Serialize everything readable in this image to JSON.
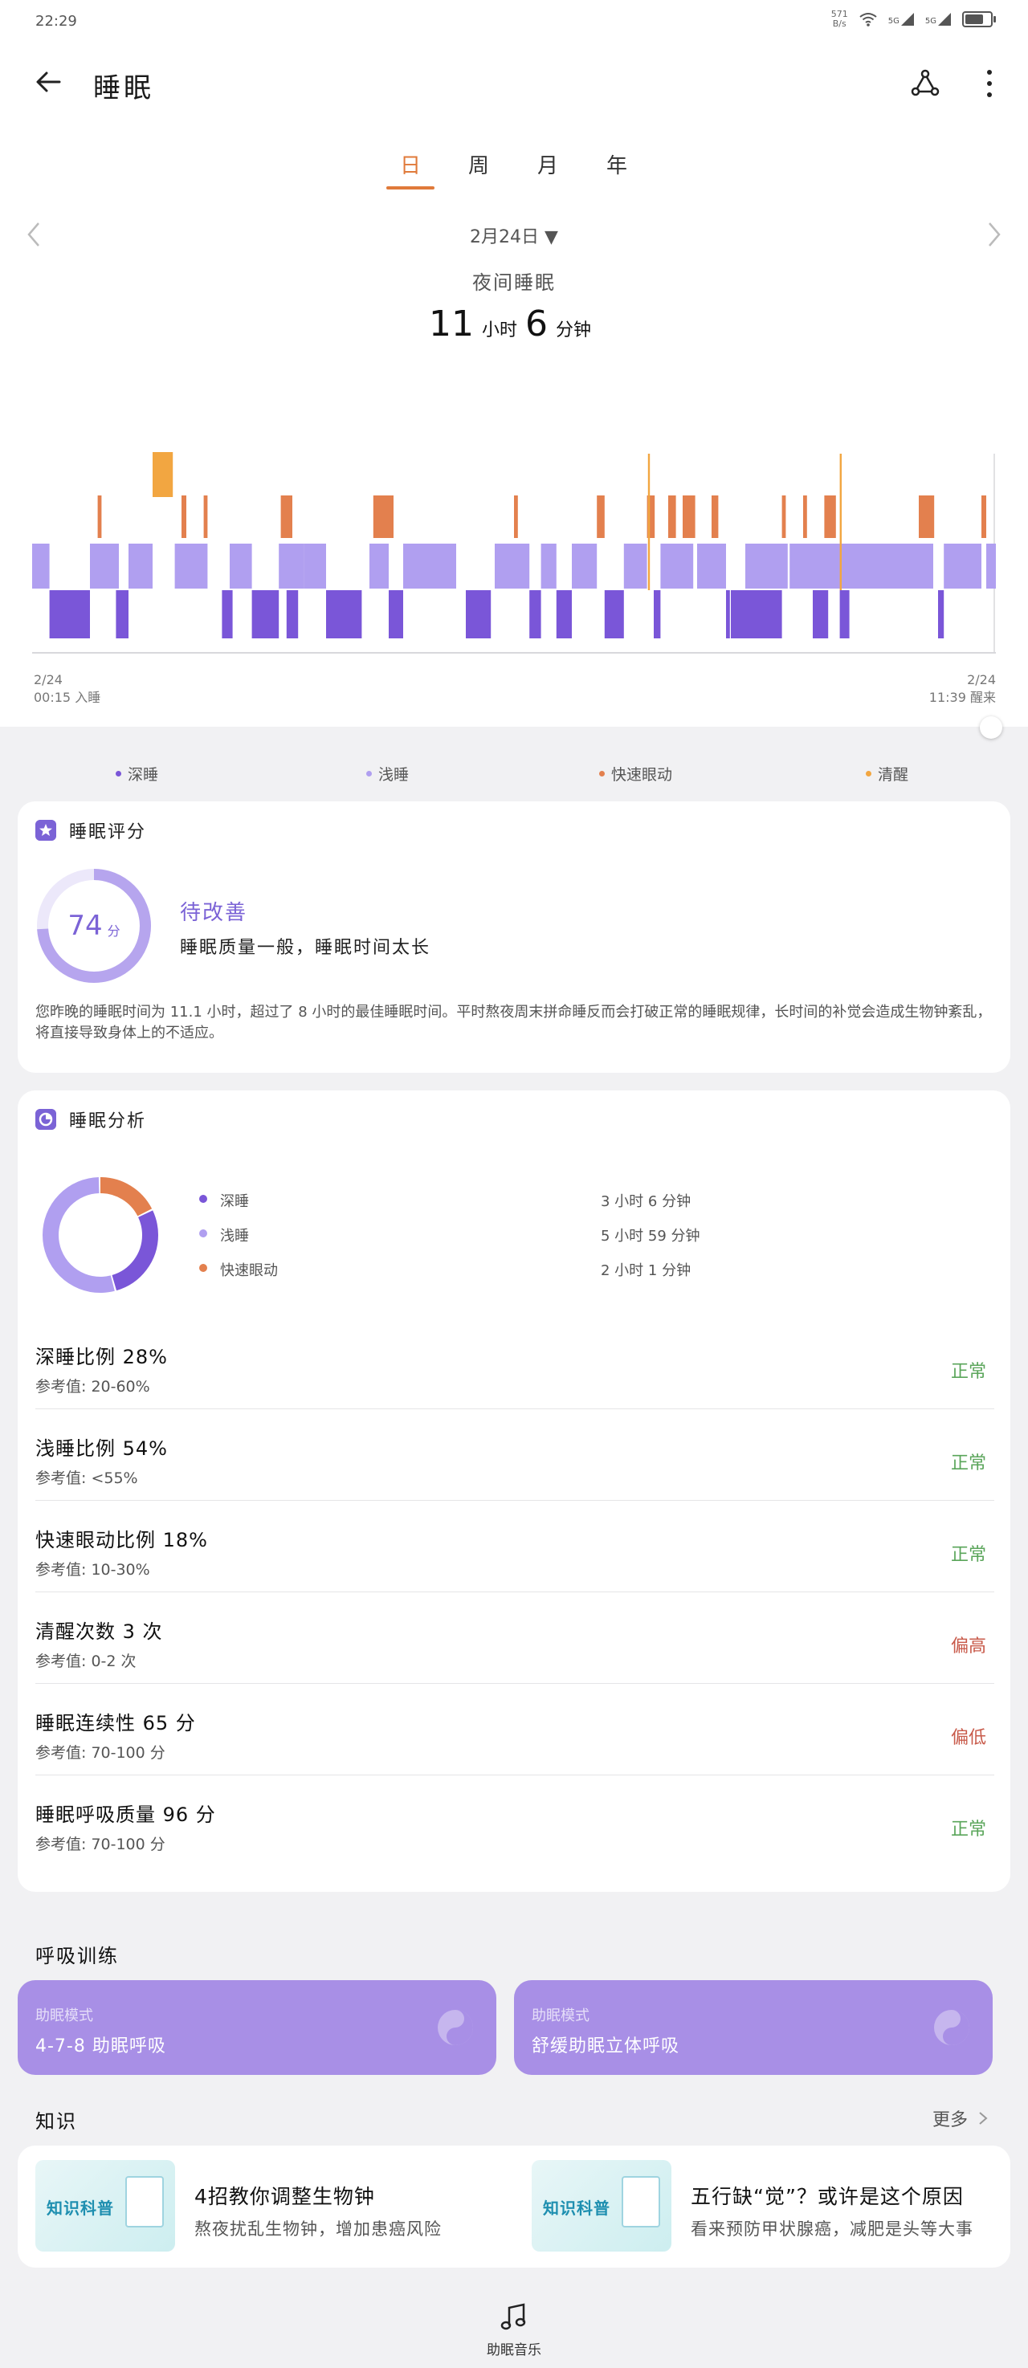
{
  "status_bar": {
    "time": "22:29",
    "net_speed": "571",
    "net_unit": "B/s",
    "signal1": "5G",
    "signal2": "5G"
  },
  "header": {
    "title": "睡眠"
  },
  "tabs": [
    {
      "label": "日",
      "active": true
    },
    {
      "label": "周",
      "active": false
    },
    {
      "label": "月",
      "active": false
    },
    {
      "label": "年",
      "active": false
    }
  ],
  "date_selector": {
    "date": "2月24日 ▼"
  },
  "summary": {
    "label": "夜间睡眠",
    "hours": "11",
    "hours_unit": "小时",
    "minutes": "6",
    "minutes_unit": "分钟"
  },
  "chart_labels": {
    "start_date": "2/24",
    "start_time": "00:15 入睡",
    "end_date": "2/24",
    "end_time": "11:39 醒来"
  },
  "chart_data": {
    "type": "timeline",
    "x_range": [
      "00:15",
      "11:39"
    ],
    "stages": [
      "清醒",
      "快速眼动",
      "浅睡",
      "深睡"
    ],
    "segments": [
      {
        "stage": "浅睡",
        "start": 0.0,
        "end": 0.018
      },
      {
        "stage": "深睡",
        "start": 0.018,
        "end": 0.06
      },
      {
        "stage": "浅睡",
        "start": 0.06,
        "end": 0.09
      },
      {
        "stage": "快速眼动",
        "start": 0.068,
        "end": 0.072
      },
      {
        "stage": "浅睡",
        "start": 0.062,
        "end": 0.078
      },
      {
        "stage": "深睡",
        "start": 0.087,
        "end": 0.1
      },
      {
        "stage": "浅睡",
        "start": 0.1,
        "end": 0.125
      },
      {
        "stage": "清醒",
        "start": 0.125,
        "end": 0.146
      },
      {
        "stage": "浅睡",
        "start": 0.148,
        "end": 0.182
      },
      {
        "stage": "快速眼动",
        "start": 0.155,
        "end": 0.16
      },
      {
        "stage": "快速眼动",
        "start": 0.178,
        "end": 0.182
      },
      {
        "stage": "深睡",
        "start": 0.197,
        "end": 0.208
      },
      {
        "stage": "浅睡",
        "start": 0.205,
        "end": 0.228
      },
      {
        "stage": "深睡",
        "start": 0.228,
        "end": 0.256
      },
      {
        "stage": "浅睡",
        "start": 0.256,
        "end": 0.282
      },
      {
        "stage": "深睡",
        "start": 0.264,
        "end": 0.276
      },
      {
        "stage": "快速眼动",
        "start": 0.258,
        "end": 0.27
      },
      {
        "stage": "浅睡",
        "start": 0.282,
        "end": 0.305
      },
      {
        "stage": "深睡",
        "start": 0.305,
        "end": 0.342
      },
      {
        "stage": "快速眼动",
        "start": 0.354,
        "end": 0.358
      },
      {
        "stage": "浅睡",
        "start": 0.35,
        "end": 0.37
      },
      {
        "stage": "深睡",
        "start": 0.37,
        "end": 0.385
      },
      {
        "stage": "快速眼动",
        "start": 0.357,
        "end": 0.375
      },
      {
        "stage": "浅睡",
        "start": 0.385,
        "end": 0.44
      },
      {
        "stage": "深睡",
        "start": 0.45,
        "end": 0.476
      },
      {
        "stage": "浅睡",
        "start": 0.48,
        "end": 0.516
      },
      {
        "stage": "快速眼动",
        "start": 0.5,
        "end": 0.504
      },
      {
        "stage": "深睡",
        "start": 0.516,
        "end": 0.528
      },
      {
        "stage": "浅睡",
        "start": 0.528,
        "end": 0.544
      },
      {
        "stage": "深睡",
        "start": 0.544,
        "end": 0.56
      },
      {
        "stage": "浅睡",
        "start": 0.56,
        "end": 0.586
      },
      {
        "stage": "快速眼动",
        "start": 0.586,
        "end": 0.594
      },
      {
        "stage": "深睡",
        "start": 0.594,
        "end": 0.614
      },
      {
        "stage": "浅睡",
        "start": 0.614,
        "end": 0.638
      },
      {
        "stage": "快速眼动",
        "start": 0.638,
        "end": 0.646
      },
      {
        "stage": "深睡",
        "start": 0.645,
        "end": 0.652
      },
      {
        "stage": "浅睡",
        "start": 0.652,
        "end": 0.686
      },
      {
        "stage": "快速眼动",
        "start": 0.66,
        "end": 0.668
      },
      {
        "stage": "快速眼动",
        "start": 0.675,
        "end": 0.688
      },
      {
        "stage": "浅睡",
        "start": 0.69,
        "end": 0.72
      },
      {
        "stage": "快速眼动",
        "start": 0.705,
        "end": 0.712
      },
      {
        "stage": "深睡",
        "start": 0.72,
        "end": 0.724
      },
      {
        "stage": "浅睡",
        "start": 0.74,
        "end": 0.784
      },
      {
        "stage": "深睡",
        "start": 0.725,
        "end": 0.778
      },
      {
        "stage": "快速眼动",
        "start": 0.778,
        "end": 0.782
      },
      {
        "stage": "快速眼动",
        "start": 0.8,
        "end": 0.804
      },
      {
        "stage": "快速眼动",
        "start": 0.822,
        "end": 0.834
      },
      {
        "stage": "浅睡",
        "start": 0.786,
        "end": 0.86
      },
      {
        "stage": "深睡",
        "start": 0.81,
        "end": 0.826
      },
      {
        "stage": "深睡",
        "start": 0.838,
        "end": 0.848
      },
      {
        "stage": "浅睡",
        "start": 0.86,
        "end": 0.9
      },
      {
        "stage": "快速眼动",
        "start": 0.92,
        "end": 0.936
      },
      {
        "stage": "浅睡",
        "start": 0.9,
        "end": 0.935
      },
      {
        "stage": "深睡",
        "start": 0.94,
        "end": 0.946
      },
      {
        "stage": "浅睡",
        "start": 0.946,
        "end": 0.985
      },
      {
        "stage": "快速眼动",
        "start": 0.985,
        "end": 0.99
      },
      {
        "stage": "浅睡",
        "start": 0.99,
        "end": 1.0
      },
      {
        "stage": "清醒",
        "start": 0.639,
        "end": 0.641
      },
      {
        "stage": "清醒",
        "start": 0.838,
        "end": 0.84
      }
    ],
    "grid": false
  },
  "legend": [
    {
      "label": "深睡",
      "color": "#7a56d8"
    },
    {
      "label": "浅睡",
      "color": "#b09ff0"
    },
    {
      "label": "快速眼动",
      "color": "#e3804e"
    },
    {
      "label": "清醒",
      "color": "#f2a641"
    }
  ],
  "score_card": {
    "title": "睡眠评分",
    "score": "74",
    "score_unit": "分",
    "score_fraction": 0.74,
    "status": "待改善",
    "description": "睡眠质量一般，睡眠时间太长",
    "paragraph": "您昨晚的睡眠时间为 11.1 小时，超过了 8 小时的最佳睡眠时间。平时熬夜周末拼命睡反而会打破正常的睡眠规律，长时间的补觉会造成生物钟紊乱，将直接导致身体上的不适应。"
  },
  "analysis_card": {
    "title": "睡眠分析",
    "breakdown": [
      {
        "label": "深睡",
        "value": "3 小时 6 分钟",
        "color": "#7a56d8",
        "percent": 28
      },
      {
        "label": "浅睡",
        "value": "5 小时 59 分钟",
        "color": "#b09ff0",
        "percent": 54
      },
      {
        "label": "快速眼动",
        "value": "2 小时 1 分钟",
        "color": "#e3804e",
        "percent": 18
      }
    ],
    "metrics": [
      {
        "name": "深睡比例  28%",
        "ref": "参考值:  20-60%",
        "status": "正常",
        "status_color": "#5aa55a"
      },
      {
        "name": "浅睡比例  54%",
        "ref": "参考值:  <55%",
        "status": "正常",
        "status_color": "#5aa55a"
      },
      {
        "name": "快速眼动比例  18%",
        "ref": "参考值:  10-30%",
        "status": "正常",
        "status_color": "#5aa55a"
      },
      {
        "name": "清醒次数  3  次",
        "ref": "参考值:  0-2  次",
        "status": "偏高",
        "status_color": "#c85a4a"
      },
      {
        "name": "睡眠连续性  65  分",
        "ref": "参考值:  70-100  分",
        "status": "偏低",
        "status_color": "#c85a4a"
      },
      {
        "name": "睡眠呼吸质量  96  分",
        "ref": "参考值:  70-100  分",
        "status": "正常",
        "status_color": "#5aa55a"
      }
    ]
  },
  "breathing": {
    "title": "呼吸训练",
    "items": [
      {
        "mode": "助眠模式",
        "name": "4-7-8 助眠呼吸"
      },
      {
        "mode": "助眠模式",
        "name": "舒缓助眠立体呼吸"
      }
    ]
  },
  "knowledge": {
    "title": "知识",
    "more": "更多",
    "items": [
      {
        "badge": "知识科普",
        "title": "4招教你调整生物钟",
        "subtitle": "熬夜扰乱生物钟，增加患癌风险"
      },
      {
        "badge": "知识科普",
        "title": "五行缺“觉”？或许是这个原因",
        "subtitle": "看来预防甲状腺癌，减肥是头等大事"
      }
    ]
  },
  "bottom_nav": {
    "label": "助眠音乐"
  },
  "colors": {
    "accent": "#e07a3a",
    "purple": "#7b63d6"
  }
}
